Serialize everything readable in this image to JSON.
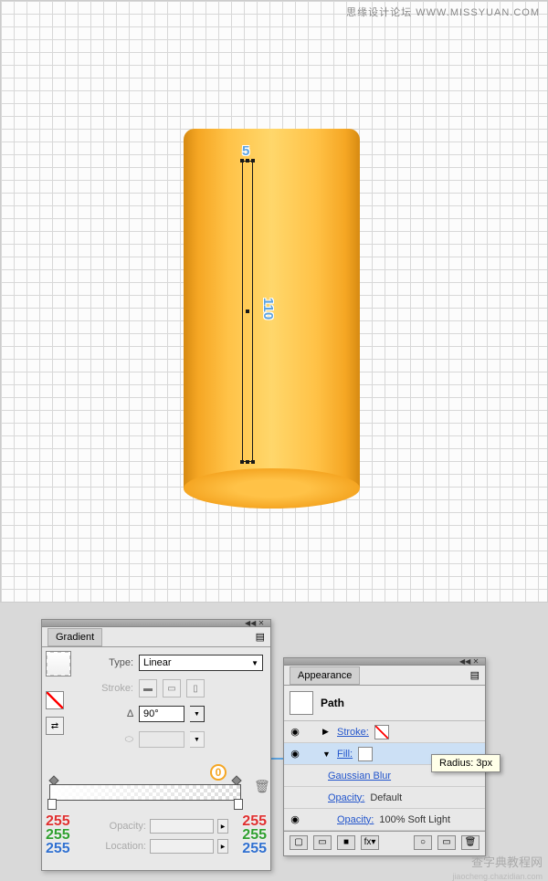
{
  "watermarks": {
    "top": "思缘设计论坛  WWW.MISSYUAN.COM",
    "bottom": "查字典教程网",
    "bottom2": "jiaocheng.chazidian.com"
  },
  "canvas": {
    "dim_width": "5",
    "dim_height": "110"
  },
  "gradient_panel": {
    "title": "Gradient",
    "type_label": "Type:",
    "type_value": "Linear",
    "stroke_label": "Stroke:",
    "angle_label": "∆",
    "angle_value": "90°",
    "aspect_label": "",
    "opacity_label": "Opacity:",
    "location_label": "Location:",
    "zero_badge": "0",
    "rgb_left": {
      "r": "255",
      "g": "255",
      "b": "255"
    },
    "rgb_right": {
      "r": "255",
      "g": "255",
      "b": "255"
    }
  },
  "appearance_panel": {
    "title": "Appearance",
    "path_label": "Path",
    "rows": [
      {
        "label": "Stroke:",
        "value": ""
      },
      {
        "label": "Fill:",
        "value": ""
      },
      {
        "label": "Gaussian Blur",
        "value": ""
      },
      {
        "label": "Opacity:",
        "value": "Default"
      },
      {
        "label": "Opacity:",
        "value": "100% Soft Light"
      }
    ]
  },
  "tooltip": "Radius: 3px",
  "icons": {
    "eye": "◉",
    "tri_right": "▶",
    "tri_down": "▼",
    "chev_left": "◀◀",
    "chev_x": "✕",
    "menu": "▤",
    "trash": "🗑",
    "circle": "○",
    "new": "▭",
    "fx": "fx▾"
  }
}
